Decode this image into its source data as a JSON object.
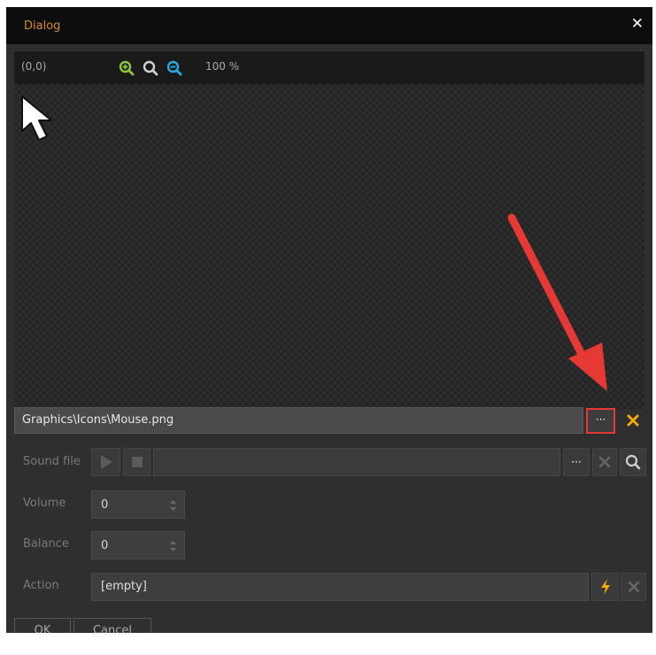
{
  "window": {
    "title": "Dialog",
    "close_icon": "close-icon"
  },
  "preview": {
    "coords": "(0,0)",
    "zoom_level": "100 %",
    "icons": [
      "zoom-in-icon",
      "zoom-reset-icon",
      "zoom-out-icon",
      "cursor-icon"
    ]
  },
  "image_path": {
    "value": "Graphics\\Icons\\Mouse.png",
    "browse_label": "···"
  },
  "sound": {
    "label": "Sound file",
    "value": "",
    "browse_label": "···"
  },
  "volume": {
    "label": "Volume",
    "value": "0"
  },
  "balance": {
    "label": "Balance",
    "value": "0"
  },
  "action": {
    "label": "Action",
    "value": "[empty]"
  },
  "buttons": {
    "ok": "OK",
    "cancel": "Cancel"
  },
  "colors": {
    "title": "#d88a2a",
    "accent_orange": "#f2a90e",
    "zoom_in": "#8dc63f",
    "zoom_out": "#29a9e0",
    "annotation": "#e53935"
  }
}
